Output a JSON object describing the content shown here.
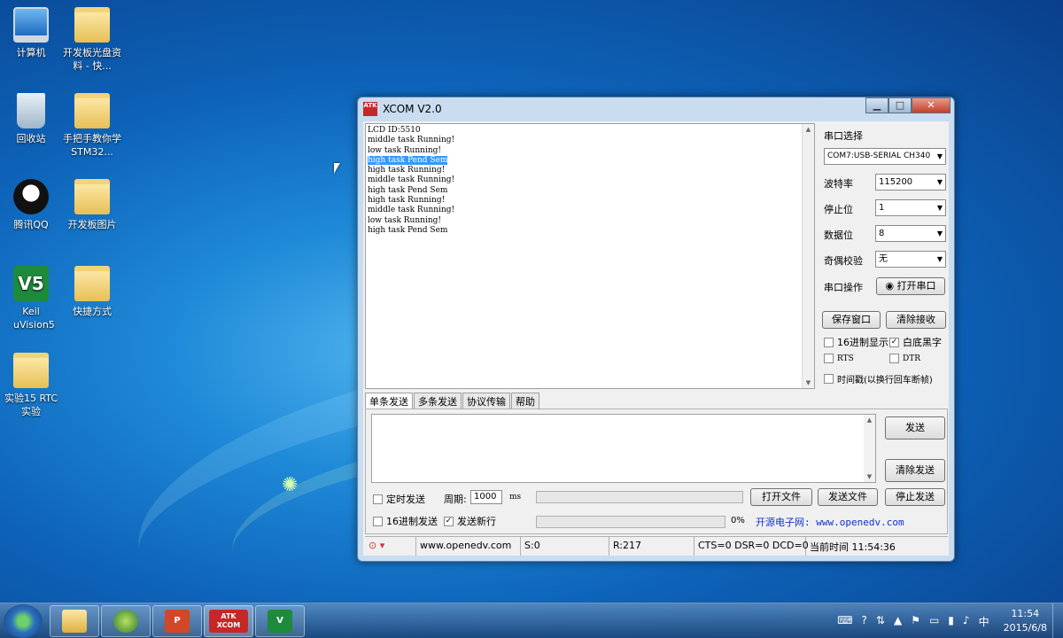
{
  "desktop": {
    "icons": [
      {
        "label": "计算机"
      },
      {
        "label": "开发板光盘资料 - 快..."
      },
      {
        "label": "回收站"
      },
      {
        "label": "手把手教你学STM32..."
      },
      {
        "label": "腾讯QQ"
      },
      {
        "label": "开发板图片"
      },
      {
        "label": "Keil uVision5"
      },
      {
        "label": "快捷方式"
      },
      {
        "label": "实验15 RTC实验"
      }
    ]
  },
  "window": {
    "title": "XCOM V2.0",
    "logo_text": "ATK",
    "receive_lines": [
      "LCD ID:5510",
      "middle task Running!",
      "low task Running!",
      "high task Pend Sem",
      "high task Running!",
      "middle task Running!",
      "high task Pend Sem",
      "high task Running!",
      "middle task Running!",
      "low task Running!",
      "high task Pend Sem"
    ],
    "highlighted_line": "high task Pend Sem",
    "panel": {
      "port_select_label": "串口选择",
      "port_value": "COM7:USB-SERIAL CH340",
      "baud_label": "波特率",
      "baud_value": "115200",
      "stop_label": "停止位",
      "stop_value": "1",
      "data_label": "数据位",
      "data_value": "8",
      "parity_label": "奇偶校验",
      "parity_value": "无",
      "port_op_label": "串口操作",
      "open_port_button": "打开串口",
      "save_window_button": "保存窗口",
      "clear_receive_button": "清除接收",
      "hex_display_label": "16进制显示",
      "hex_display_checked": false,
      "white_bg_label": "白底黑字",
      "white_bg_checked": true,
      "rts_label": "RTS",
      "dtr_label": "DTR",
      "timestamp_label": "时间戳(以换行回车断帧)"
    },
    "tabs": [
      "单条发送",
      "多条发送",
      "协议传输",
      "帮助"
    ],
    "send": {
      "send_button": "发送",
      "clear_send_button": "清除发送",
      "timed_send_label": "定时发送",
      "period_label": "周期:",
      "period_value": "1000",
      "period_unit": "ms",
      "open_file_button": "打开文件",
      "send_file_button": "发送文件",
      "stop_send_button": "停止发送",
      "hex_send_label": "16进制发送",
      "newline_label": "发送新行",
      "newline_checked": true,
      "progress_text": "0%",
      "progress": 0,
      "site_link": "开源电子网: www.openedv.com"
    },
    "status": {
      "url": "www.openedv.com",
      "sent": "S:0",
      "received": "R:217",
      "lines": "CTS=0 DSR=0 DCD=0",
      "time": "当前时间 11:54:36"
    }
  },
  "taskbar": {
    "clock_time": "11:54",
    "clock_date": "2015/6/8",
    "atk_label": "ATK XCOM"
  }
}
